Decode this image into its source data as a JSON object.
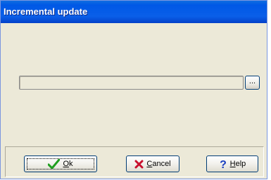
{
  "window": {
    "title": "Incremental update"
  },
  "path_field": {
    "value": ""
  },
  "browse_button": {
    "label": "..."
  },
  "buttons": {
    "ok": {
      "mnemonic": "O",
      "rest": "k",
      "icon": "checkmark-icon"
    },
    "cancel": {
      "mnemonic": "C",
      "rest": "ancel",
      "icon": "red-x-icon"
    },
    "help": {
      "mnemonic": "H",
      "rest": "elp",
      "icon": "question-mark-icon"
    }
  },
  "colors": {
    "titlebar": "#0058e6",
    "window_bg": "#ece9d8",
    "check_green": "#1f9e1f",
    "cross_red": "#c8102e",
    "help_blue": "#1a3fc0"
  }
}
